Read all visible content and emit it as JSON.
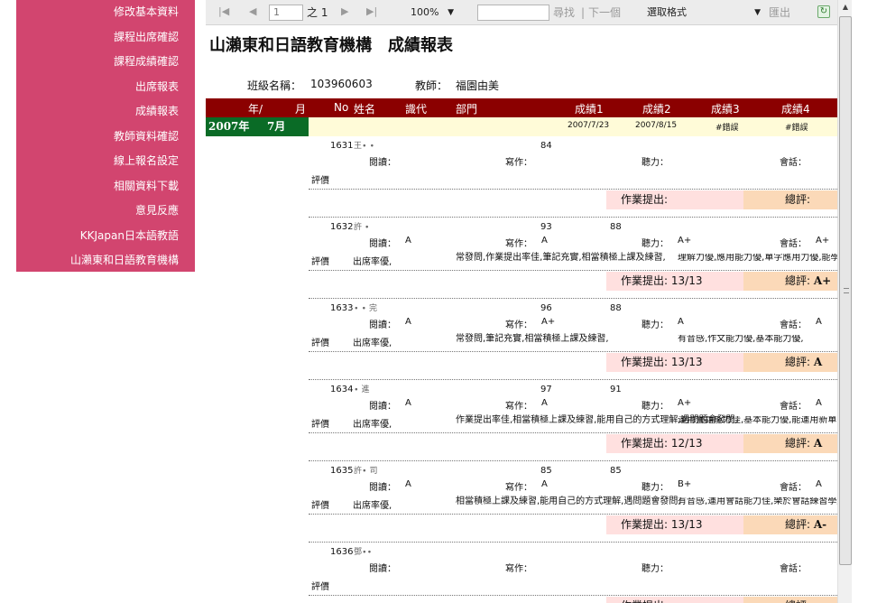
{
  "sidebar": {
    "items": [
      "修改基本資料",
      "課程出席確認",
      "課程成績確認",
      "出席報表",
      "成績報表",
      "教師資料確認",
      "線上報名設定",
      "相關資料下載",
      "意見反應",
      "KKJapan日本語教語",
      "山瀨東和日語教育機構"
    ]
  },
  "toolbar": {
    "page_current": "1",
    "page_of": "之 1",
    "zoom": "100%",
    "search_value": "",
    "find_label": "尋找",
    "separator": "|",
    "next_label": "下一個",
    "format_value": "選取格式",
    "export_label": "匯出"
  },
  "report": {
    "title": "山瀨東和日語教育機構　成績報表",
    "class_label": "班級名稱：",
    "class_value": "103960603",
    "teacher_label": "教師：",
    "teacher_value": "福園由美",
    "columns": [
      "年/",
      "月",
      "No",
      "姓名",
      "識代",
      "部門",
      "成績1",
      "成績2",
      "成績3",
      "成績4"
    ],
    "group": {
      "year": "2007年",
      "month": "7月",
      "date1": "2007/7/23",
      "date2": "2007/8/15",
      "err1": "#錯誤",
      "err2": "#錯誤"
    },
    "labels": {
      "reading": "閱讀：",
      "writing": "寫作：",
      "listening": "聽力：",
      "speaking": "會話：",
      "evaluation": "評價",
      "homework": "作業提出:",
      "total": "總評:"
    },
    "students": [
      {
        "no": "1631",
        "name": "王∙ ∙",
        "score1": "84",
        "score2": "",
        "reading": "",
        "writing": "",
        "listening": "",
        "speaking": "",
        "comment1": "",
        "comment2": "",
        "comment3": "",
        "homework": "",
        "total": ""
      },
      {
        "no": "1632",
        "name": "許 ∙",
        "score1": "93",
        "score2": "88",
        "reading": "A",
        "writing": "A",
        "listening": "A+",
        "speaking": "A+",
        "comment1": "出席率優,",
        "comment2": "常發問,作業提出率佳,筆記充實,相當積極上課及練習,",
        "comment3": "理解力優,應用能力優,單字應用力優,能學到的單字,",
        "homework": "13/13",
        "total": "A+"
      },
      {
        "no": "1633",
        "name": "∙ ∙ 完",
        "score1": "96",
        "score2": "88",
        "reading": "A",
        "writing": "A+",
        "listening": "A",
        "speaking": "A",
        "comment1": "出席率優,",
        "comment2": "常發問,筆記充實,相當積極上課及練習,",
        "comment3": "有音感,作文能力優,基本能力優,",
        "homework": "13/13",
        "total": "A"
      },
      {
        "no": "1634",
        "name": "∙ 進",
        "score1": "97",
        "score2": "91",
        "reading": "A",
        "writing": "A",
        "listening": "A+",
        "speaking": "A",
        "comment1": "出席率優,",
        "comment2": "作業提出率佳,相當積極上課及練習,能用自己的方式理解,遇問題會發問,",
        "comment3": "運用會話能力佳,基本能力優,能運用新單字,",
        "homework": "12/13",
        "total": "A"
      },
      {
        "no": "1635",
        "name": "許∙ 司",
        "score1": "85",
        "score2": "85",
        "reading": "A",
        "writing": "A",
        "listening": "B+",
        "speaking": "A",
        "comment1": "出席率優,",
        "comment2": "相當積極上課及練習,能用自己的方式理解,遇問題會發問,",
        "comment3": "有音感,運用會話能力佳,樂於會話練習學過的句型用在文章會寫上,",
        "homework": "13/13",
        "total": "A-"
      },
      {
        "no": "1636",
        "name": "鄧∙∙",
        "score1": "",
        "score2": "",
        "reading": "",
        "writing": "",
        "listening": "",
        "speaking": "",
        "comment1": "",
        "comment2": "",
        "comment3": "",
        "homework": "",
        "total": ""
      }
    ]
  },
  "icons": {
    "first_page": "first-page-icon",
    "prev_page": "prev-page-icon",
    "next_page": "next-page-icon",
    "last_page": "last-page-icon",
    "refresh": "refresh-icon"
  },
  "colors": {
    "sidebar_bg": "#d2456f",
    "header_bg": "#8b0000",
    "group_bg": "#0a6b26",
    "group_fill": "#fffbd8",
    "homework_bg": "#ffe0df",
    "total_bg": "#fbd9b8"
  }
}
